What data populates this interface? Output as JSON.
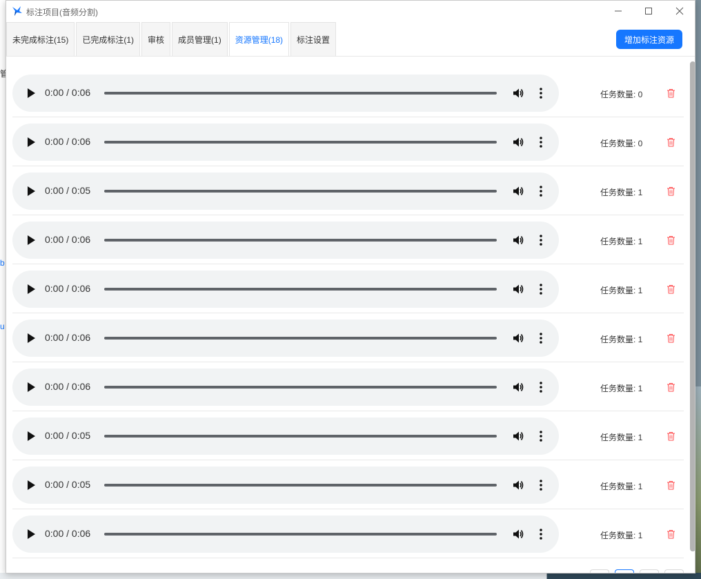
{
  "window": {
    "title": "标注项目(音频分割)"
  },
  "background": {
    "fragments": [
      "管",
      "b",
      "u"
    ]
  },
  "tabs": [
    {
      "label": "未完成标注(15)",
      "active": false
    },
    {
      "label": "已完成标注(1)",
      "active": false
    },
    {
      "label": "审核",
      "active": false
    },
    {
      "label": "成员管理(1)",
      "active": false
    },
    {
      "label": "资源管理(18)",
      "active": true
    },
    {
      "label": "标注设置",
      "active": false
    }
  ],
  "toolbar": {
    "add_label": "增加标注资源"
  },
  "resources": [
    {
      "time": "0:00 / 0:06",
      "task_count": "任务数量: 0"
    },
    {
      "time": "0:00 / 0:06",
      "task_count": "任务数量: 0"
    },
    {
      "time": "0:00 / 0:05",
      "task_count": "任务数量: 1"
    },
    {
      "time": "0:00 / 0:06",
      "task_count": "任务数量: 1"
    },
    {
      "time": "0:00 / 0:06",
      "task_count": "任务数量: 1"
    },
    {
      "time": "0:00 / 0:06",
      "task_count": "任务数量: 1"
    },
    {
      "time": "0:00 / 0:06",
      "task_count": "任务数量: 1"
    },
    {
      "time": "0:00 / 0:05",
      "task_count": "任务数量: 1"
    },
    {
      "time": "0:00 / 0:05",
      "task_count": "任务数量: 1"
    },
    {
      "time": "0:00 / 0:06",
      "task_count": "任务数量: 1"
    }
  ],
  "icons": {
    "play": "play-icon",
    "volume": "volume-icon",
    "menu": "more-vertical-icon",
    "delete": "trash-icon"
  },
  "colors": {
    "accent": "#1677ff",
    "delete": "#ff4d4f"
  }
}
